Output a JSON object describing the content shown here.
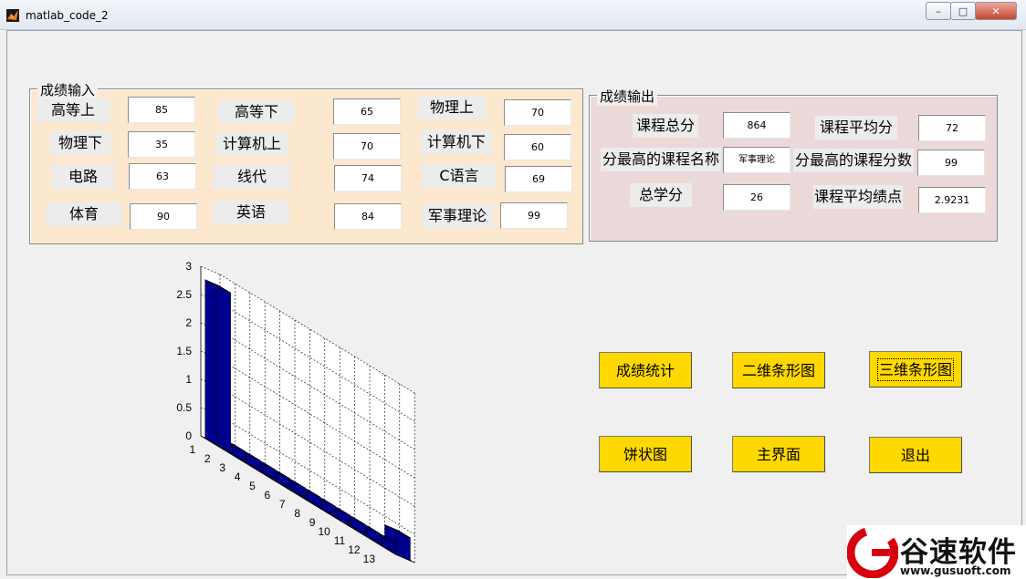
{
  "window": {
    "title": "matlab_code_2"
  },
  "input_panel": {
    "title": "成绩输入",
    "fields": [
      {
        "label": "高等上",
        "value": "85"
      },
      {
        "label": "高等下",
        "value": "65"
      },
      {
        "label": "物理上",
        "value": "70"
      },
      {
        "label": "物理下",
        "value": "35"
      },
      {
        "label": "计算机上",
        "value": "70"
      },
      {
        "label": "计算机下",
        "value": "60"
      },
      {
        "label": "电路",
        "value": "63"
      },
      {
        "label": "线代",
        "value": "74"
      },
      {
        "label": "C语言",
        "value": "69"
      },
      {
        "label": "体育",
        "value": "90"
      },
      {
        "label": "英语",
        "value": "84"
      },
      {
        "label": "军事理论",
        "value": "99"
      }
    ]
  },
  "output_panel": {
    "title": "成绩输出",
    "fields": [
      {
        "label": "课程总分",
        "value": "864"
      },
      {
        "label": "课程平均分",
        "value": "72"
      },
      {
        "label": "分最高的课程名称",
        "value": "军事理论"
      },
      {
        "label": "分最高的课程分数",
        "value": "99"
      },
      {
        "label": "总学分",
        "value": "26"
      },
      {
        "label": "课程平均绩点",
        "value": "2.9231"
      }
    ]
  },
  "buttons": {
    "stats": "成绩统计",
    "bar2d": "二维条形图",
    "bar3d": "三维条形图",
    "pie": "饼状图",
    "main": "主界面",
    "exit": "退出"
  },
  "chart_data": {
    "type": "bar",
    "title": "",
    "xlabel": "",
    "ylabel": "",
    "categories": [
      "1",
      "2",
      "3",
      "4",
      "5",
      "6",
      "7",
      "8",
      "9",
      "10",
      "11",
      "12",
      "13"
    ],
    "values": [
      2.8,
      0.15,
      0.15,
      0.15,
      0.15,
      0.15,
      0.15,
      0.15,
      0.15,
      0.15,
      0.15,
      0.15,
      0.4
    ],
    "ylim": [
      0,
      3
    ],
    "yticks": [
      "0",
      "0.5",
      "1",
      "1.5",
      "2",
      "2.5",
      "3"
    ],
    "grid": true,
    "color": "#00008f"
  },
  "watermark": {
    "text": "谷速软件",
    "url": "www.gusuoft.com",
    "accent": "#d7000f"
  }
}
